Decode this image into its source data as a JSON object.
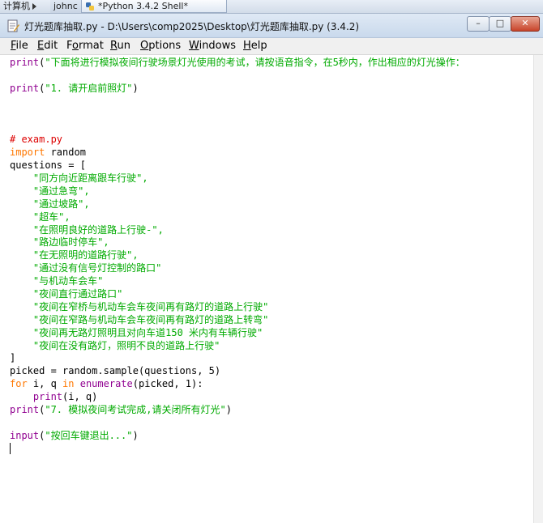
{
  "taskbar": {
    "item1": "计算机",
    "item1b": "johnc",
    "item2": "*Python 3.4.2 Shell*"
  },
  "window": {
    "title": "灯光题库抽取.py - D:\\Users\\comp2025\\Desktop\\灯光题库抽取.py (3.4.2)",
    "min_glyph": "–",
    "max_glyph": "□",
    "close_glyph": "✕"
  },
  "menu": {
    "file": {
      "u": "F",
      "rest": "ile"
    },
    "edit": {
      "u": "E",
      "rest": "dit"
    },
    "format": {
      "pre": "F",
      "u": "o",
      "rest": "rmat"
    },
    "run": {
      "u": "R",
      "rest": "un"
    },
    "options": {
      "u": "O",
      "rest": "ptions"
    },
    "windows": {
      "u": "W",
      "rest": "indows"
    },
    "help": {
      "u": "H",
      "rest": "elp"
    }
  },
  "code": {
    "l1_fn": "print",
    "l1_a": "(",
    "l1_str": "\"下面将进行模拟夜间行驶场景灯光使用的考试，请按语音指令，在5秒内，作出相应的灯光操作：",
    "l3_fn": "print",
    "l3_a": "(",
    "l3_str": "\"1. 请开启前照灯\"",
    "l3_b": ")",
    "l7_comment": "# exam.py",
    "l8_kw": "import",
    "l8_rest": " random",
    "l9": "questions = [",
    "questions": [
      "\"同方向近距离跟车行驶\",",
      "\"通过急弯\",",
      "\"通过坡路\",",
      "\"超车\",",
      "\"在照明良好的道路上行驶-\",",
      "\"路边临时停车\",",
      "\"在无照明的道路行驶\",",
      "\"通过没有信号灯控制的路口\"",
      "\"与机动车会车\"",
      "\"夜间直行通过路口\"",
      "\"夜间在窄桥与机动车会车夜间再有路灯的道路上行驶\"",
      "\"夜间在窄路与机动车会车夜间再有路灯的道路上转弯\"",
      "\"夜间再无路灯照明且对向车道150 米内有车辆行驶\"",
      "\"夜间在没有路灯，照明不良的道路上行驶\""
    ],
    "l24": "]",
    "l25": "picked = random.sample(questions, 5)",
    "l26_kw1": "for",
    "l26_a": " i, q ",
    "l26_kw2": "in",
    "l26_sp": " ",
    "l26_bi": "enumerate",
    "l26_b": "(picked, 1):",
    "l27_indent": "    ",
    "l27_fn": "print",
    "l27_b": "(i, q)",
    "l28_fn": "print",
    "l28_a": "(",
    "l28_str": "\"7. 模拟夜间考试完成,请关闭所有灯光\"",
    "l28_b": ")",
    "l30_fn": "input",
    "l30_a": "(",
    "l30_str": "\"按回车键退出...\"",
    "l30_b": ")"
  },
  "colors": {
    "keyword": "#ff7700",
    "builtin": "#900090",
    "string": "#00aa00",
    "comment": "#dd0000"
  }
}
